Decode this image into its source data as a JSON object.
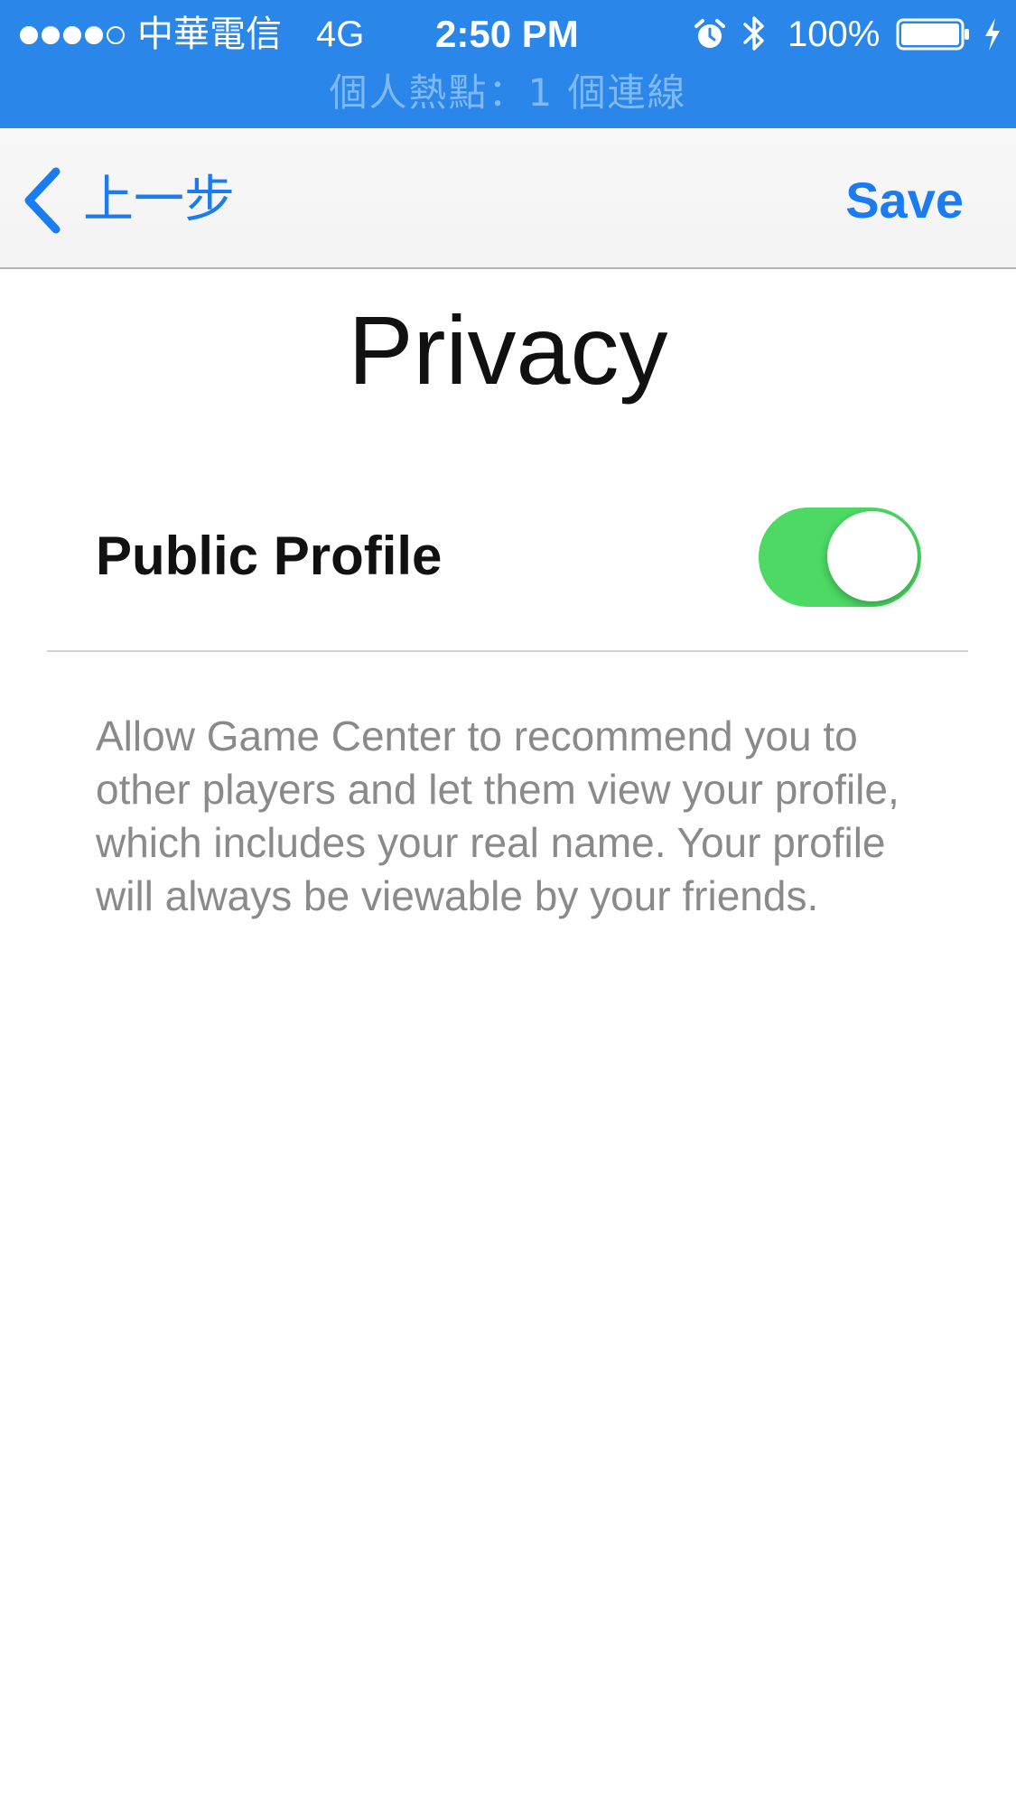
{
  "status_bar": {
    "carrier": "中華電信",
    "network": "4G",
    "time": "2:50 PM",
    "battery_percent": "100%",
    "signal_bars_filled": 4,
    "signal_bars_total": 5,
    "hotspot_text": "個人熱點：1 個連線",
    "icons": [
      "alarm-icon",
      "bluetooth-icon",
      "battery-icon",
      "charging-bolt-icon"
    ],
    "background_color": "#2a86e8"
  },
  "nav": {
    "back_label": "上一步",
    "save_label": "Save",
    "accent_color": "#1a7cf0"
  },
  "page": {
    "title": "Privacy"
  },
  "settings": {
    "public_profile": {
      "label": "Public Profile",
      "enabled": true,
      "on_color": "#4cd964"
    },
    "description": "Allow Game Center to recommend you to other players and let them view your profile, which includes your real name. Your profile will always be viewable by your friends."
  }
}
